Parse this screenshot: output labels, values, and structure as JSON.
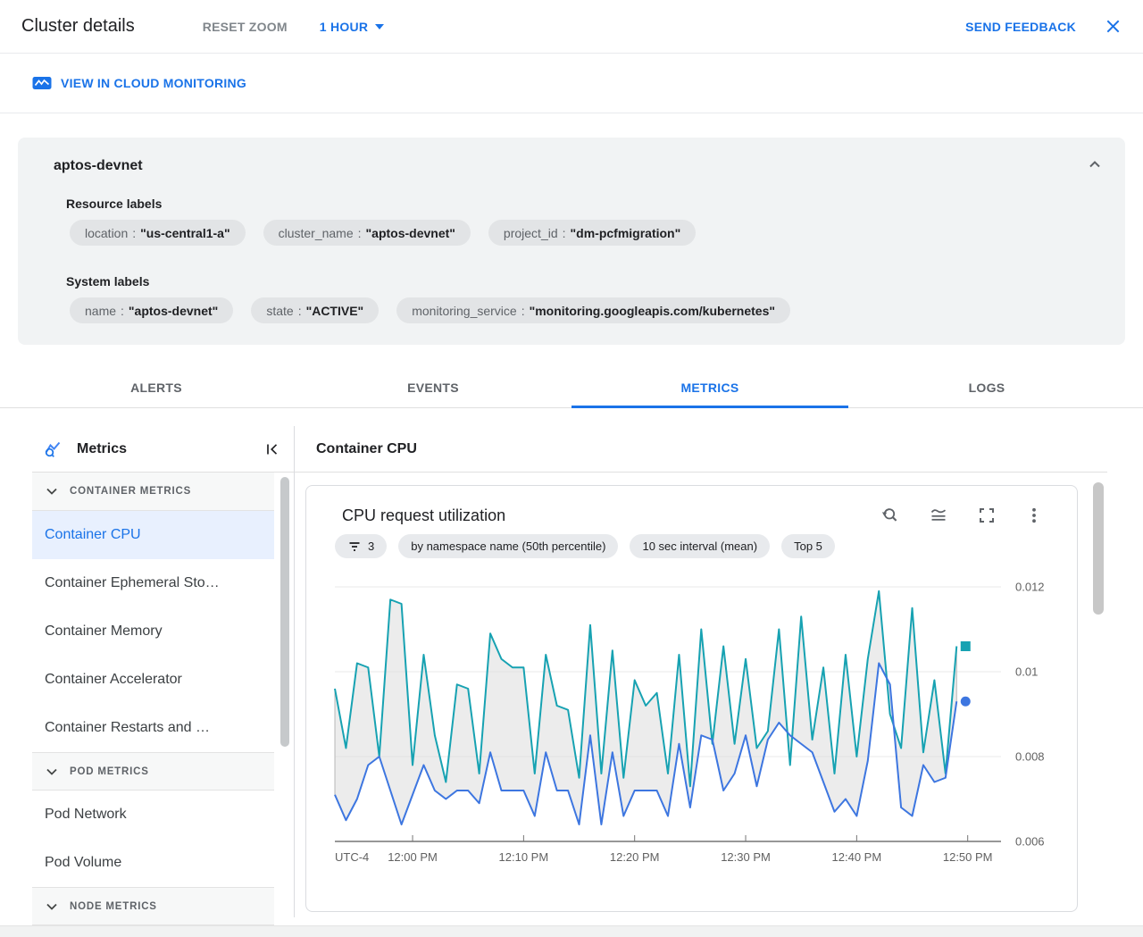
{
  "header": {
    "title": "Cluster details",
    "reset_zoom_label": "RESET ZOOM",
    "time_range_label": "1 HOUR",
    "send_feedback_label": "SEND FEEDBACK"
  },
  "toolbar_link": {
    "label": "VIEW IN CLOUD MONITORING"
  },
  "cluster_card": {
    "title": "aptos-devnet",
    "separator": ":",
    "resource_labels_heading": "Resource labels",
    "resource_labels": [
      {
        "key": "location",
        "value": "\"us-central1-a\""
      },
      {
        "key": "cluster_name",
        "value": "\"aptos-devnet\""
      },
      {
        "key": "project_id",
        "value": "\"dm-pcfmigration\""
      }
    ],
    "system_labels_heading": "System labels",
    "system_labels": [
      {
        "key": "name",
        "value": "\"aptos-devnet\""
      },
      {
        "key": "state",
        "value": "\"ACTIVE\""
      },
      {
        "key": "monitoring_service",
        "value": "\"monitoring.googleapis.com/kubernetes\""
      }
    ]
  },
  "tabs": [
    {
      "label": "ALERTS",
      "active": false
    },
    {
      "label": "EVENTS",
      "active": false
    },
    {
      "label": "METRICS",
      "active": true
    },
    {
      "label": "LOGS",
      "active": false
    }
  ],
  "sidebar": {
    "title": "Metrics",
    "sections": [
      {
        "label": "CONTAINER METRICS",
        "items": [
          {
            "label": "Container CPU",
            "selected": true
          },
          {
            "label": "Container Ephemeral Sto…",
            "selected": false
          },
          {
            "label": "Container Memory",
            "selected": false
          },
          {
            "label": "Container Accelerator",
            "selected": false
          },
          {
            "label": "Container Restarts and …",
            "selected": false
          }
        ]
      },
      {
        "label": "POD METRICS",
        "items": [
          {
            "label": "Pod Network",
            "selected": false
          },
          {
            "label": "Pod Volume",
            "selected": false
          }
        ]
      },
      {
        "label": "NODE METRICS",
        "items": []
      }
    ]
  },
  "main": {
    "pane_title": "Container CPU",
    "chart_title": "CPU request utilization",
    "chips": [
      {
        "icon": "filter-icon",
        "label": "3"
      },
      {
        "label": "by namespace name (50th percentile)"
      },
      {
        "label": "10 sec interval (mean)"
      },
      {
        "label": "Top 5"
      }
    ]
  },
  "chart_data": {
    "type": "line",
    "title": "CPU request utilization",
    "x_axis": {
      "timezone_label": "UTC-4",
      "tick_labels": [
        "12:00 PM",
        "12:10 PM",
        "12:20 PM",
        "12:30 PM",
        "12:40 PM",
        "12:50 PM"
      ],
      "tick_minutes": [
        7,
        17,
        27,
        37,
        47,
        57
      ],
      "domain_minutes": [
        0,
        60
      ]
    },
    "y_axis": {
      "ticks": [
        0.006,
        0.008,
        0.01,
        0.012
      ],
      "range": [
        0.006,
        0.0122
      ],
      "grid": true
    },
    "legend": "none",
    "sample_interval_minutes": 1,
    "band": {
      "between": [
        "teal-series",
        "blue-series"
      ],
      "fill": "#dcdcdc",
      "stroke": "#a8a8a8"
    },
    "series": [
      {
        "id": "teal-series",
        "color": "#17a2b2",
        "end_marker": "square",
        "values": [
          0.0096,
          0.0082,
          0.0102,
          0.0101,
          0.008,
          0.0117,
          0.0116,
          0.0078,
          0.0104,
          0.0085,
          0.0074,
          0.0097,
          0.0096,
          0.0076,
          0.0109,
          0.0103,
          0.0101,
          0.0101,
          0.0076,
          0.0104,
          0.0092,
          0.0091,
          0.0075,
          0.0111,
          0.0076,
          0.0105,
          0.0075,
          0.0098,
          0.0092,
          0.0095,
          0.0076,
          0.0104,
          0.0073,
          0.011,
          0.0083,
          0.0106,
          0.0083,
          0.0103,
          0.0082,
          0.0086,
          0.011,
          0.0078,
          0.0113,
          0.0084,
          0.0101,
          0.0076,
          0.0104,
          0.008,
          0.0103,
          0.0119,
          0.009,
          0.0082,
          0.0115,
          0.0081,
          0.0098,
          0.0076,
          0.0106
        ]
      },
      {
        "id": "blue-series",
        "color": "#3d76e0",
        "end_marker": "circle",
        "values": [
          0.0071,
          0.0065,
          0.007,
          0.0078,
          0.008,
          0.0072,
          0.0064,
          0.0071,
          0.0078,
          0.0072,
          0.007,
          0.0072,
          0.0072,
          0.0069,
          0.0081,
          0.0072,
          0.0072,
          0.0072,
          0.0066,
          0.0081,
          0.0072,
          0.0072,
          0.0064,
          0.0085,
          0.0064,
          0.0081,
          0.0066,
          0.0072,
          0.0072,
          0.0072,
          0.0066,
          0.0083,
          0.0068,
          0.0085,
          0.0084,
          0.0072,
          0.0076,
          0.0085,
          0.0073,
          0.0084,
          0.0088,
          0.0085,
          0.0083,
          0.0081,
          0.0074,
          0.0067,
          0.007,
          0.0066,
          0.0079,
          0.0102,
          0.0097,
          0.0068,
          0.0066,
          0.0078,
          0.0074,
          0.0075,
          0.0093
        ]
      }
    ]
  },
  "colors": {
    "accent_blue": "#1a73e8",
    "teal_series": "#17a2b2",
    "blue_series": "#3d76e0",
    "selected_item_bg": "#e8f0fe",
    "card_bg": "#f1f3f4"
  }
}
